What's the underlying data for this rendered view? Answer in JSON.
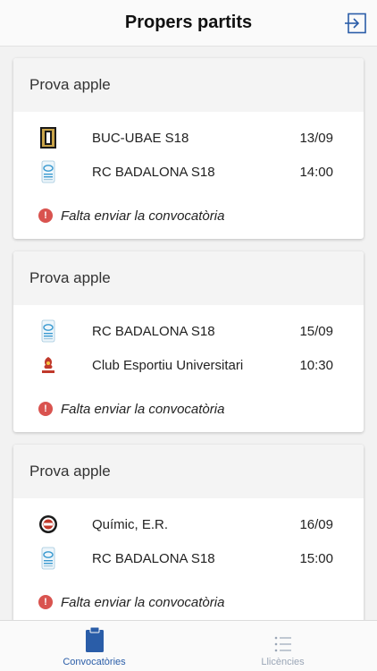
{
  "header": {
    "title": "Propers partits"
  },
  "matches": [
    {
      "title": "Prova apple",
      "home": {
        "name": "BUC-UBAE S18",
        "logo": "buc-ubae-logo"
      },
      "away": {
        "name": "RC BADALONA S18",
        "logo": "rc-badalona-logo"
      },
      "date": "13/09",
      "time": "14:00",
      "warning": "Falta enviar la convocatòria"
    },
    {
      "title": "Prova apple",
      "home": {
        "name": "RC BADALONA S18",
        "logo": "rc-badalona-logo"
      },
      "away": {
        "name": "Club Esportiu Universitari",
        "logo": "ceu-logo"
      },
      "date": "15/09",
      "time": "10:30",
      "warning": "Falta enviar la convocatòria"
    },
    {
      "title": "Prova apple",
      "home": {
        "name": "Químic, E.R.",
        "logo": "quimic-logo"
      },
      "away": {
        "name": "RC BADALONA S18",
        "logo": "rc-badalona-logo"
      },
      "date": "16/09",
      "time": "15:00",
      "warning": "Falta enviar la convocatòria"
    }
  ],
  "tabbar": {
    "convocatories": {
      "label": "Convocatòries",
      "icon": "clipboard-icon",
      "active": true
    },
    "llicencies": {
      "label": "Llicències",
      "icon": "list-icon",
      "active": false
    }
  },
  "colors": {
    "accent": "#2a5da8",
    "warning": "#d9534f",
    "inactive": "#9aa6b6"
  }
}
